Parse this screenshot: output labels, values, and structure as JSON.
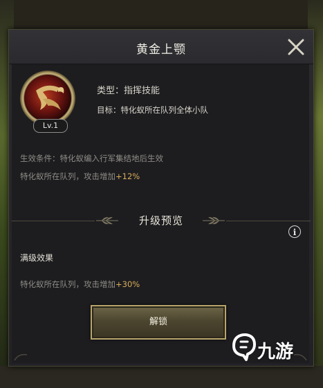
{
  "dialog": {
    "title": "黄金上颚"
  },
  "skill": {
    "level": "Lv.1",
    "type": "类型：指挥技能",
    "target": "目标：特化蚁所在队列全体小队",
    "condition": "生效条件：特化蚁编入行军集结地后生效",
    "effect_prefix": "特化蚁所在队列，攻击增加",
    "effect_value": "+12%"
  },
  "upgrade": {
    "section_title": "升级预览",
    "max_label": "满级效果",
    "max_effect_prefix": "特化蚁所在队列，攻击增加",
    "max_effect_value": "+30%"
  },
  "actions": {
    "unlock_label": "解锁"
  },
  "watermark": {
    "text": "九游"
  },
  "icons": {
    "close": "close-icon",
    "info": "info-icon",
    "skill": "golden-mandible-icon",
    "laurel": "laurel-icon"
  },
  "colors": {
    "accent_gold": "#d8ad5a",
    "button_border": "#b8a56c",
    "panel_bg": "#1d1d20"
  }
}
